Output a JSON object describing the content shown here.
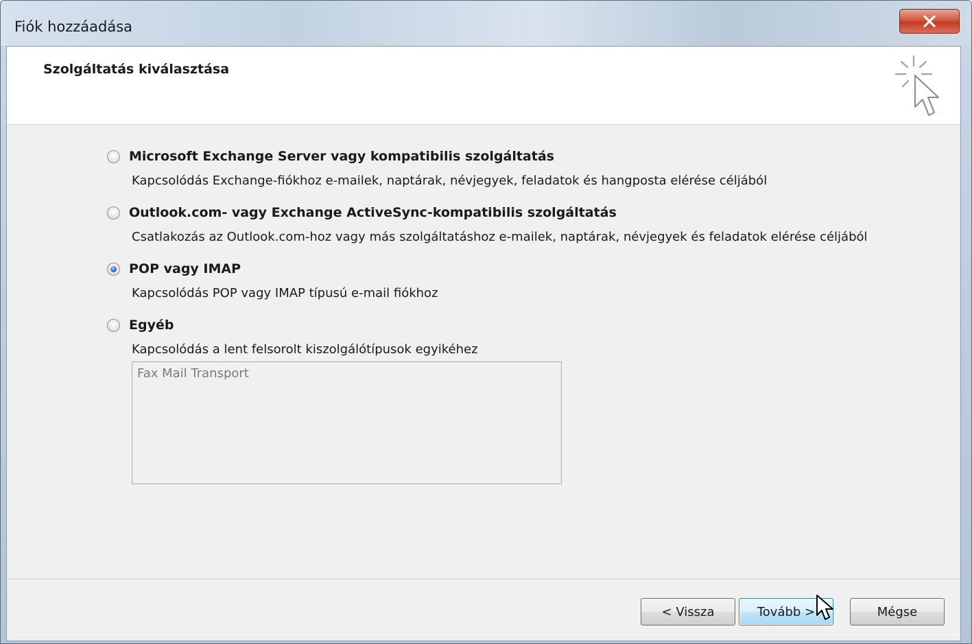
{
  "window": {
    "title": "Fiók hozzáadása",
    "close_label": "X"
  },
  "header": {
    "title": "Szolgáltatás kiválasztása",
    "icon": "wizard-sparkle-cursor-icon"
  },
  "options": [
    {
      "label": "Microsoft Exchange Server vagy kompatibilis szolgáltatás",
      "description": "Kapcsolódás Exchange-fiókhoz e-mailek, naptárak, névjegyek, feladatok és hangposta elérése céljából",
      "checked": false
    },
    {
      "label": "Outlook.com- vagy Exchange ActiveSync-kompatibilis szolgáltatás",
      "description": "Csatlakozás az Outlook.com-hoz vagy más szolgáltatáshoz e-mailek, naptárak, névjegyek és feladatok elérése céljából",
      "checked": false
    },
    {
      "label": "POP vagy IMAP",
      "description": "Kapcsolódás POP vagy IMAP típusú e-mail fiókhoz",
      "checked": true
    },
    {
      "label": "Egyéb",
      "description": "Kapcsolódás a lent felsorolt kiszolgálótípusok egyikéhez",
      "checked": false
    }
  ],
  "server_list": {
    "items": [
      "Fax Mail Transport"
    ]
  },
  "buttons": {
    "back": "< Vissza",
    "next": "Tovább >",
    "cancel": "Mégse"
  },
  "colors": {
    "accent": "#2b73c4",
    "close": "#c23b22"
  }
}
